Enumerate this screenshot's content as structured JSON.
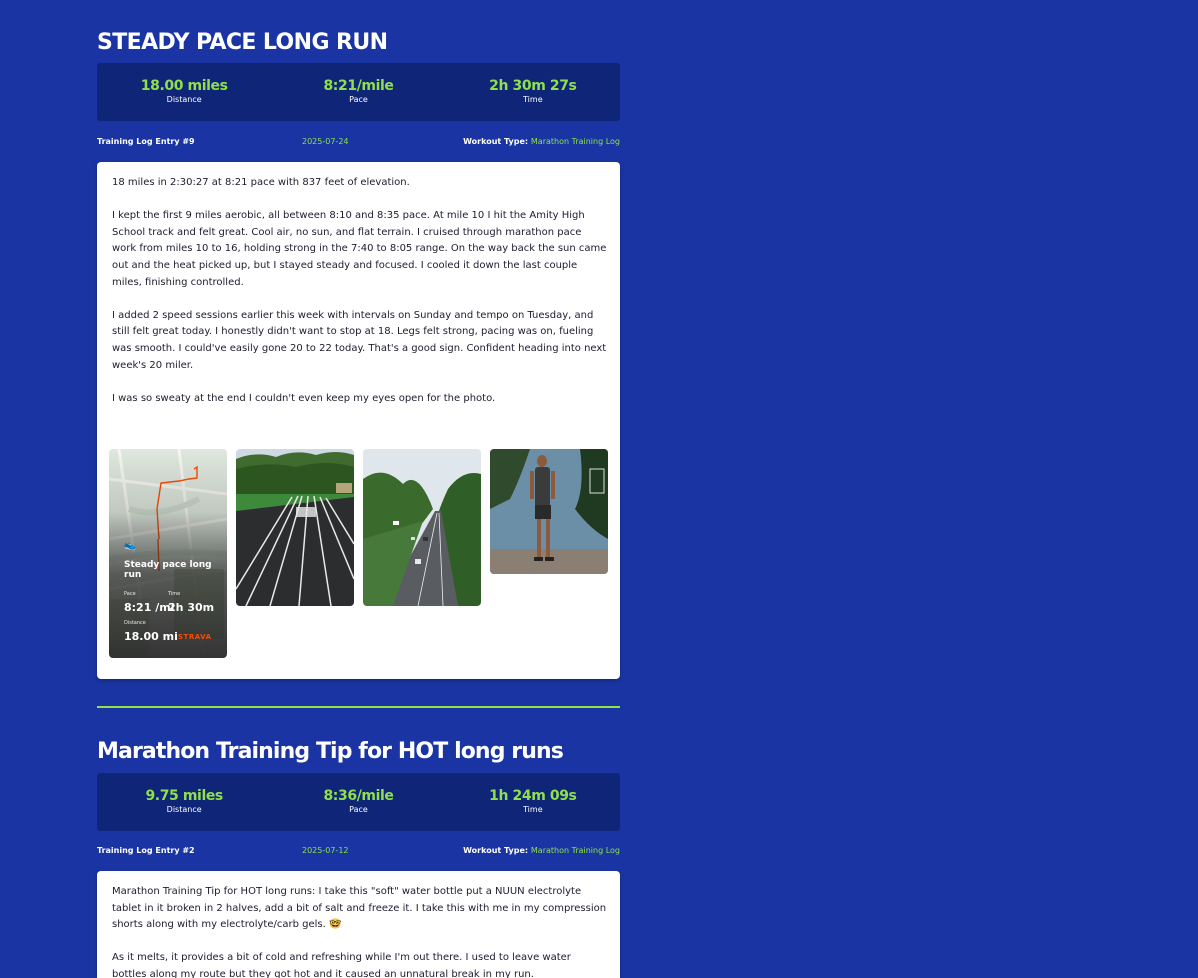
{
  "posts": [
    {
      "title": "STEADY PACE LONG RUN",
      "stats": [
        {
          "value": "18.00 miles",
          "label": "Distance"
        },
        {
          "value": "8:21/mile",
          "label": "Pace"
        },
        {
          "value": "2h 30m 27s",
          "label": "Time"
        }
      ],
      "entry": "Training Log Entry #9",
      "date": "2025-07-24",
      "workout_type_label": "Workout Type:",
      "workout_type_value": "Marathon Training Log",
      "paragraphs": [
        "18 miles in 2:30:27 at 8:21 pace with 837 feet of elevation.",
        "I kept the first 9 miles aerobic, all between 8:10 and 8:35 pace. At mile 10 I hit the Amity High School track and felt great. Cool air, no sun, and flat terrain. I cruised through marathon pace work from miles 10 to 16, holding strong in the 7:40 to 8:05 range. On the way back the sun came out and the heat picked up, but I stayed steady and focused. I cooled it down the last couple miles, finishing controlled.",
        "I added 2 speed sessions earlier this week with intervals on Sunday and tempo on Tuesday, and still felt great today. I honestly didn't want to stop at 18. Legs felt strong, pacing was on, fueling was smooth. I could've easily gone 20 to 22 today. That's a good sign. Confident heading into next week's 20 miler.",
        "I was so sweaty at the end I couldn't even keep my eyes open for the photo."
      ],
      "strava": {
        "title": "Steady pace long run",
        "pace_label": "Pace",
        "time_label": "Time",
        "pace_value": "8:21 /mi",
        "time_value": "2h 30m",
        "distance_label": "Distance",
        "distance_value": "18.00 mi",
        "brand": "STRAVA"
      }
    },
    {
      "title": "Marathon Training Tip for HOT long runs",
      "stats": [
        {
          "value": "9.75 miles",
          "label": "Distance"
        },
        {
          "value": "8:36/mile",
          "label": "Pace"
        },
        {
          "value": "1h 24m 09s",
          "label": "Time"
        }
      ],
      "entry": "Training Log Entry #2",
      "date": "2025-07-12",
      "workout_type_label": "Workout Type:",
      "workout_type_value": "Marathon Training Log",
      "paragraphs": [
        "Marathon Training Tip for HOT long runs: I take this \"soft\" water bottle put a NUUN electrolyte tablet in it broken in 2 halves, add a bit of salt and freeze it. I take this with me in my compression shorts along with my electrolyte/carb gels. 🤓",
        "As it melts, it provides a bit of cold and refreshing while I'm out there. I used to leave water bottles along my route but they got hot and it caused an unnatural break in my run."
      ]
    }
  ],
  "colors": {
    "background": "#1a35a3",
    "stats_panel": "#0f2578",
    "accent_green": "#8fe04a",
    "strava_orange": "#fc4c02"
  }
}
